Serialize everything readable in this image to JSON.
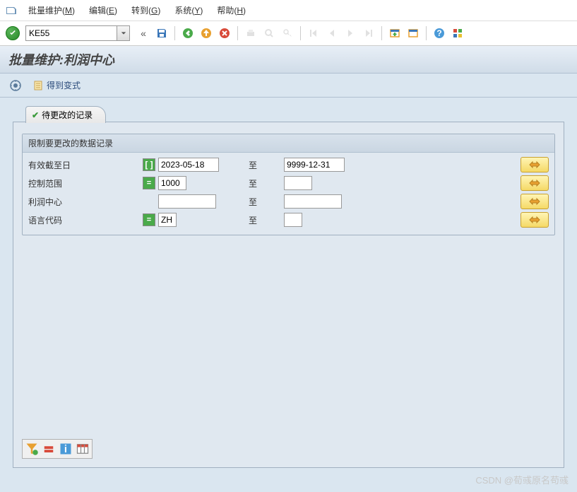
{
  "menu": {
    "items": [
      {
        "label": "批量维护(M)",
        "key": "M"
      },
      {
        "label": "编辑(E)",
        "key": "E"
      },
      {
        "label": "转到(G)",
        "key": "G"
      },
      {
        "label": "系统(Y)",
        "key": "Y"
      },
      {
        "label": "帮助(H)",
        "key": "H"
      }
    ]
  },
  "toolbar": {
    "tcode": "KE55",
    "back_glyph": "«"
  },
  "title": "批量维护:利润中心",
  "app_toolbar": {
    "get_variant": "得到变式"
  },
  "tab": {
    "label": "待更改的记录"
  },
  "group": {
    "title": "限制要更改的数据记录",
    "to_label": "至",
    "rows": [
      {
        "label": "有效截至日",
        "icon": "interval",
        "from": "2023-05-18",
        "to": "9999-12-31",
        "from_w": 86,
        "to_w": 86
      },
      {
        "label": "控制范围",
        "icon": "single",
        "from": "1000",
        "to": "",
        "from_w": 40,
        "to_w": 40
      },
      {
        "label": "利润中心",
        "icon": "",
        "from": "",
        "to": "",
        "from_w": 82,
        "to_w": 82
      },
      {
        "label": "语言代码",
        "icon": "single",
        "from": "ZH",
        "to": "",
        "from_w": 26,
        "to_w": 26
      }
    ]
  },
  "watermark": "CSDN @荀彧原名苟彧"
}
